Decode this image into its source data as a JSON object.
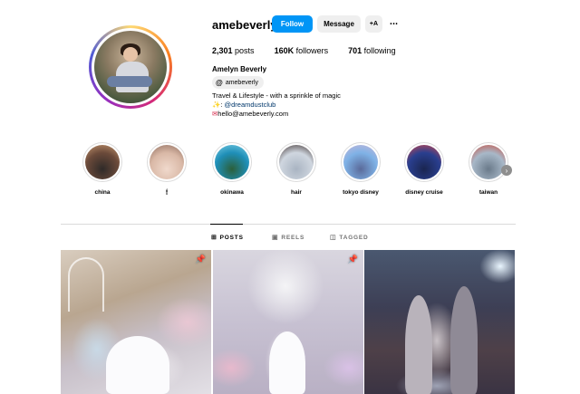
{
  "profile": {
    "username": "amebeverly",
    "follow_label": "Follow",
    "message_label": "Message",
    "add_user_icon": "+A",
    "more_icon": "•••",
    "posts_count": "2,301",
    "posts_label": "posts",
    "followers_count": "160K",
    "followers_label": "followers",
    "following_count": "701",
    "following_label": "following",
    "full_name": "Amelyn Beverly",
    "threads_handle": "amebeverly",
    "bio_line1": "Travel & Lifestyle - with a sprinkle of magic",
    "bio_line2_icon": "✨",
    "bio_line2_prefix": ": ",
    "bio_line2_link": "@dreamdustclub",
    "bio_line3_icon": "✉",
    "bio_line3": "hello@amebeverly.com"
  },
  "highlights": [
    {
      "label": "china",
      "colors": [
        "#6b4a3a",
        "#c99a72",
        "#2f2a28"
      ]
    },
    {
      "label": "🕯",
      "colors": [
        "#d9b8a6",
        "#8c6a5c",
        "#f0d9cc"
      ]
    },
    {
      "label": "okinawa",
      "colors": [
        "#1f8fb8",
        "#7fd0e6",
        "#2b5f3a"
      ]
    },
    {
      "label": "hair",
      "colors": [
        "#cfd6df",
        "#3a2c2a",
        "#a9b4c2"
      ]
    },
    {
      "label": "tokyo disney",
      "colors": [
        "#7fb2e6",
        "#c9b8d9",
        "#5a6a9a"
      ]
    },
    {
      "label": "disney cruise",
      "colors": [
        "#2a3f8f",
        "#d94a4a",
        "#1a2550"
      ]
    },
    {
      "label": "taiwan",
      "colors": [
        "#a8b8c8",
        "#c94a3a",
        "#6a7a8a"
      ]
    }
  ],
  "tabs": [
    {
      "label": "POSTS",
      "icon": "⊞",
      "active": true
    },
    {
      "label": "REELS",
      "icon": "▣",
      "active": false
    },
    {
      "label": "TAGGED",
      "icon": "◫",
      "active": false
    }
  ],
  "posts": [
    {
      "pinned": true,
      "pin_icon": "📌"
    },
    {
      "pinned": true,
      "pin_icon": "📌"
    },
    {
      "pinned": false,
      "pin_icon": ""
    }
  ],
  "colors": {
    "accent": "#0095f6",
    "link": "#00376b",
    "secondary_button": "#efefef",
    "divider": "#dbdbdb"
  }
}
